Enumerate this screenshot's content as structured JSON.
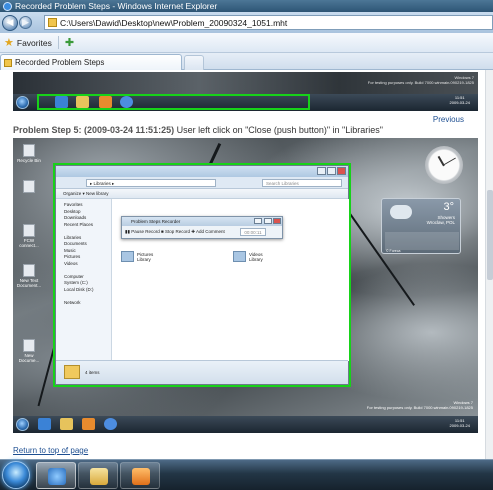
{
  "window": {
    "title": "Recorded Problem Steps - Windows Internet Explorer"
  },
  "address": {
    "url": "C:\\Users\\Dawid\\Desktop\\new\\Problem_20090324_1051.mht"
  },
  "favorites": {
    "label": "Favorites"
  },
  "tabs": [
    {
      "label": "Recorded Problem Steps"
    }
  ],
  "content": {
    "previous_link": "Previous",
    "step_heading": "Problem Step 5: (2009-03-24 11:51:25)",
    "step_desc": "User left click on \"Close (push button)\" in \"Libraries\"",
    "return_link": "Return to top of page",
    "shot_watermark": "Windows 7\nFor testing purposes only. Build 7000.winmain.090219-1825",
    "shot_clock": "11:51\n2009-03-24",
    "weather": {
      "temp": "3°",
      "cond": "Showers\nWroclaw, POL",
      "source": "© Foreca"
    },
    "desktop_icons": [
      "Recycle Bin",
      "FCW connect...",
      "New Text Document...",
      "New Docume..."
    ],
    "explorer": {
      "crumb": "▸ Libraries ▸",
      "search": "Search Libraries",
      "cmd": "Organize ▾    New library",
      "side": [
        "Favorites",
        "Desktop",
        "Downloads",
        "Recent Places",
        "",
        "Libraries",
        "Documents",
        "Music",
        "Pictures",
        "Videos",
        "",
        "Computer",
        "System (C:)",
        "Local Disk (D:)",
        "",
        "Network"
      ],
      "items": [
        {
          "name": "Documents",
          "sub": "Library"
        },
        {
          "name": "Pictures",
          "sub": "Library"
        },
        {
          "name": "Videos",
          "sub": "Library"
        }
      ],
      "footer": "4 items"
    },
    "psr": {
      "title": "Problem Steps Recorder",
      "buttons": "▮▮ Pause Record   ■ Stop Record   ✚ Add Comment",
      "timer": "00:00:11"
    }
  }
}
